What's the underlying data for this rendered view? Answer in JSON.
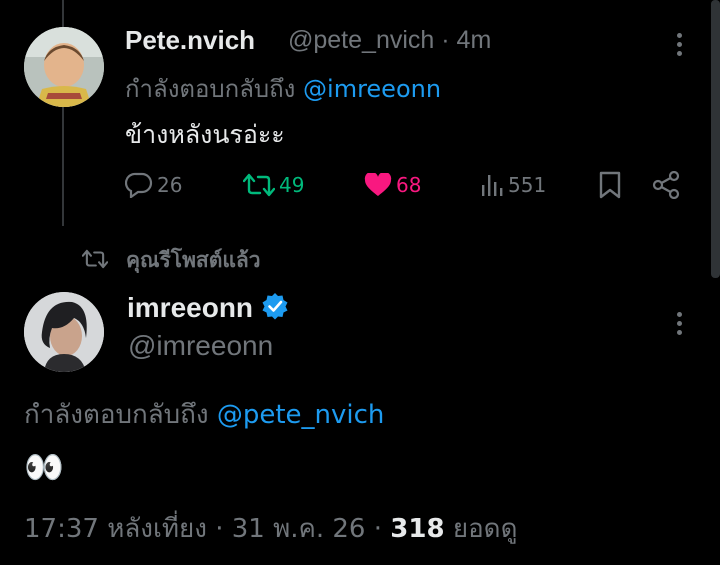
{
  "reply_tweet": {
    "display_name": "Pete.nvich",
    "handle": "@pete_nvich",
    "separator": "·",
    "time": "4m",
    "replying_to_label": "กำลังตอบกลับถึง",
    "replying_to_handle": "@imreeonn",
    "text": "ข้างหลังนรอ่ะะ",
    "actions": {
      "replies": "26",
      "retweets": "49",
      "likes": "68",
      "views": "551"
    }
  },
  "retweet_banner": {
    "label": "คุณรีโพสต์แล้ว"
  },
  "main_tweet": {
    "display_name": "imreeonn",
    "handle": "@imreeonn",
    "replying_to_label": "กำลังตอบกลับถึง",
    "replying_to_handle": "@pete_nvich",
    "text": "👀",
    "time": "17:37 หลังเที่ยง",
    "separator1": "·",
    "date": "31 พ.ค. 26",
    "separator2": "·",
    "views_count": "318",
    "views_label": "ยอดดู"
  },
  "colors": {
    "accent": "#1d9bf0",
    "retweet_green": "#00ba7c",
    "like_pink": "#f91880",
    "muted": "#71767b",
    "text": "#e7e9ea"
  },
  "icons": [
    "reply-icon",
    "retweet-icon",
    "heart-icon",
    "views-icon",
    "bookmark-icon",
    "share-icon",
    "more-icon",
    "verified-badge-icon"
  ]
}
